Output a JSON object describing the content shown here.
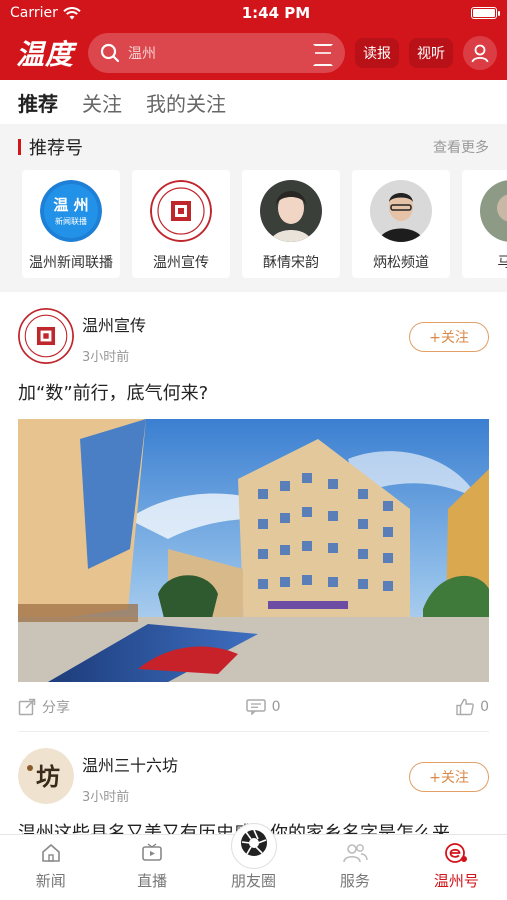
{
  "status": {
    "carrier": "Carrier",
    "time": "1:44 PM",
    "battery_level": 1.0
  },
  "header": {
    "logo": "温度",
    "search_placeholder": "温州",
    "read_paper": "读报",
    "video": "视听"
  },
  "tabs": [
    {
      "label": "推荐"
    },
    {
      "label": "关注"
    },
    {
      "label": "我的关注"
    }
  ],
  "recommend": {
    "title": "推荐号",
    "more": "查看更多",
    "cards": [
      {
        "name": "温州新闻联播",
        "logo_text": "温 州",
        "logo_sub": "新闻联播"
      },
      {
        "name": "温州宣传"
      },
      {
        "name": "酥情宋韵"
      },
      {
        "name": "炳松频道"
      },
      {
        "name": "马..."
      }
    ]
  },
  "posts": [
    {
      "author": "温州宣传",
      "time": "3小时前",
      "follow": "+关注",
      "title": "加“数”前行，底气何来?",
      "share": "分享",
      "comments": "0",
      "likes": "0"
    },
    {
      "author": "温州三十六坊",
      "time": "3小时前",
      "follow": "+关注",
      "title": "温州这些县名又美又有历史感！你的家乡名字是怎么来",
      "avatar_text": "坊"
    }
  ],
  "tabbar": [
    {
      "label": "新闻",
      "icon": "home-icon"
    },
    {
      "label": "直播",
      "icon": "live-tv-icon"
    },
    {
      "label": "朋友圈",
      "icon": "aperture-icon"
    },
    {
      "label": "服务",
      "icon": "people-icon"
    },
    {
      "label": "温州号",
      "icon": "wenzhou-e-icon"
    }
  ],
  "colors": {
    "brand_red": "#d2141b",
    "follow_orange": "#d98a4a"
  }
}
